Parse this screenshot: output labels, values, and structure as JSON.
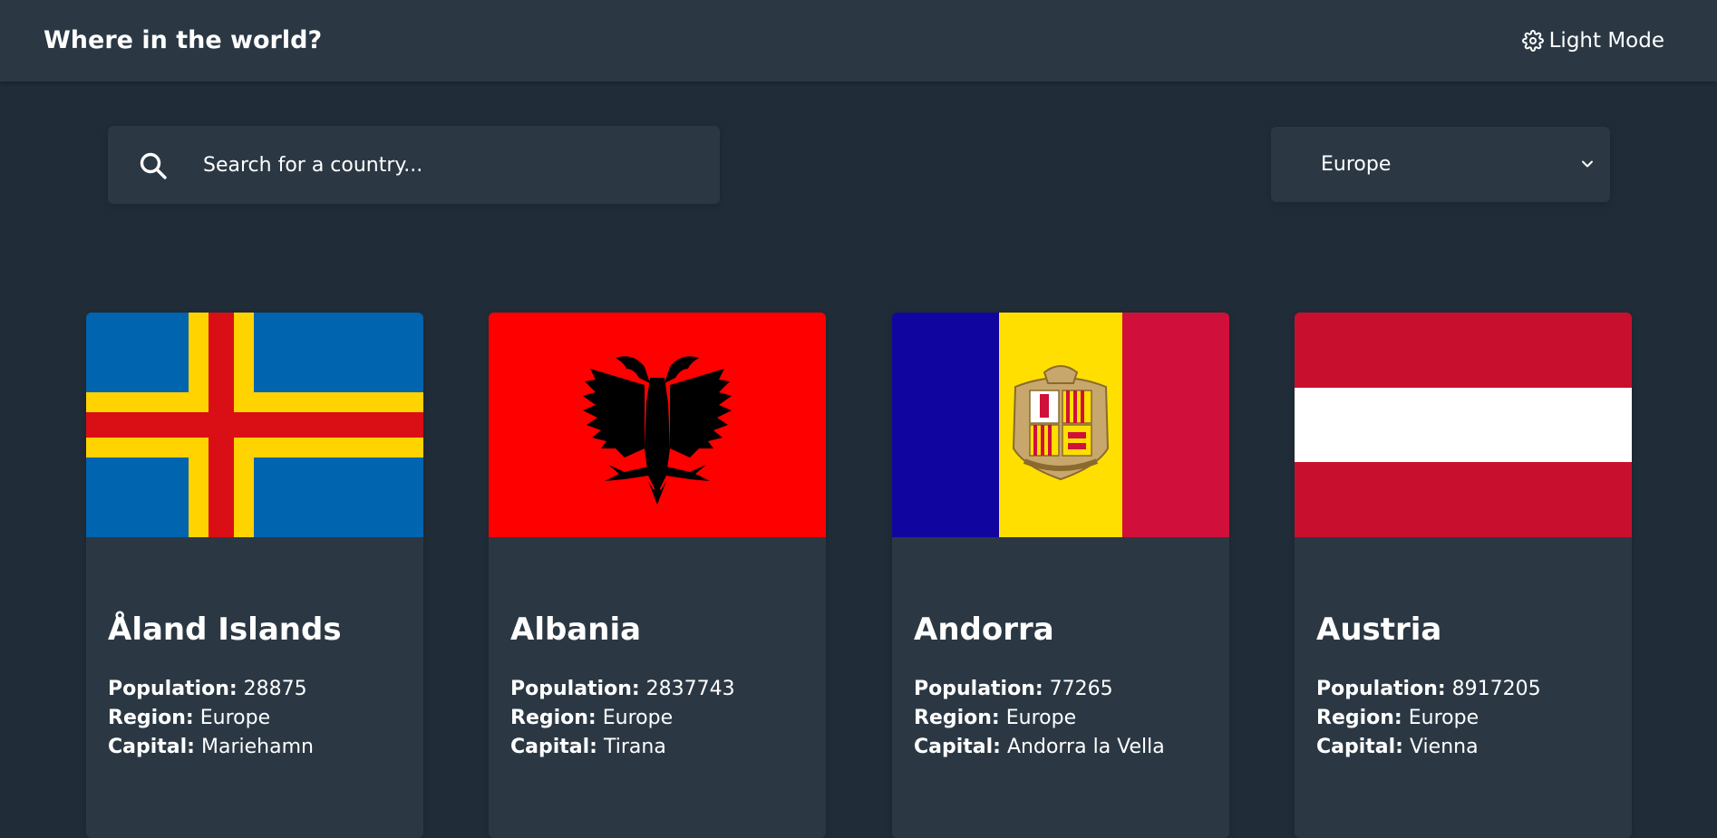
{
  "header": {
    "title": "Where in the world?",
    "mode_label": "Light Mode"
  },
  "search": {
    "placeholder": "Search for a country..."
  },
  "filter": {
    "selected": "Europe"
  },
  "labels": {
    "population": "Population:",
    "region": "Region:",
    "capital": "Capital:"
  },
  "countries": [
    {
      "name": "Åland Islands",
      "population": "28875",
      "region": "Europe",
      "capital": "Mariehamn"
    },
    {
      "name": "Albania",
      "population": "2837743",
      "region": "Europe",
      "capital": "Tirana"
    },
    {
      "name": "Andorra",
      "population": "77265",
      "region": "Europe",
      "capital": "Andorra la Vella"
    },
    {
      "name": "Austria",
      "population": "8917205",
      "region": "Europe",
      "capital": "Vienna"
    }
  ],
  "colors": {
    "background": "#202c37",
    "surface": "#2b3844",
    "text": "#ffffff"
  },
  "icons": {
    "mode_toggle": "gear-icon",
    "search": "search-icon",
    "dropdown": "chevron-down-icon"
  }
}
